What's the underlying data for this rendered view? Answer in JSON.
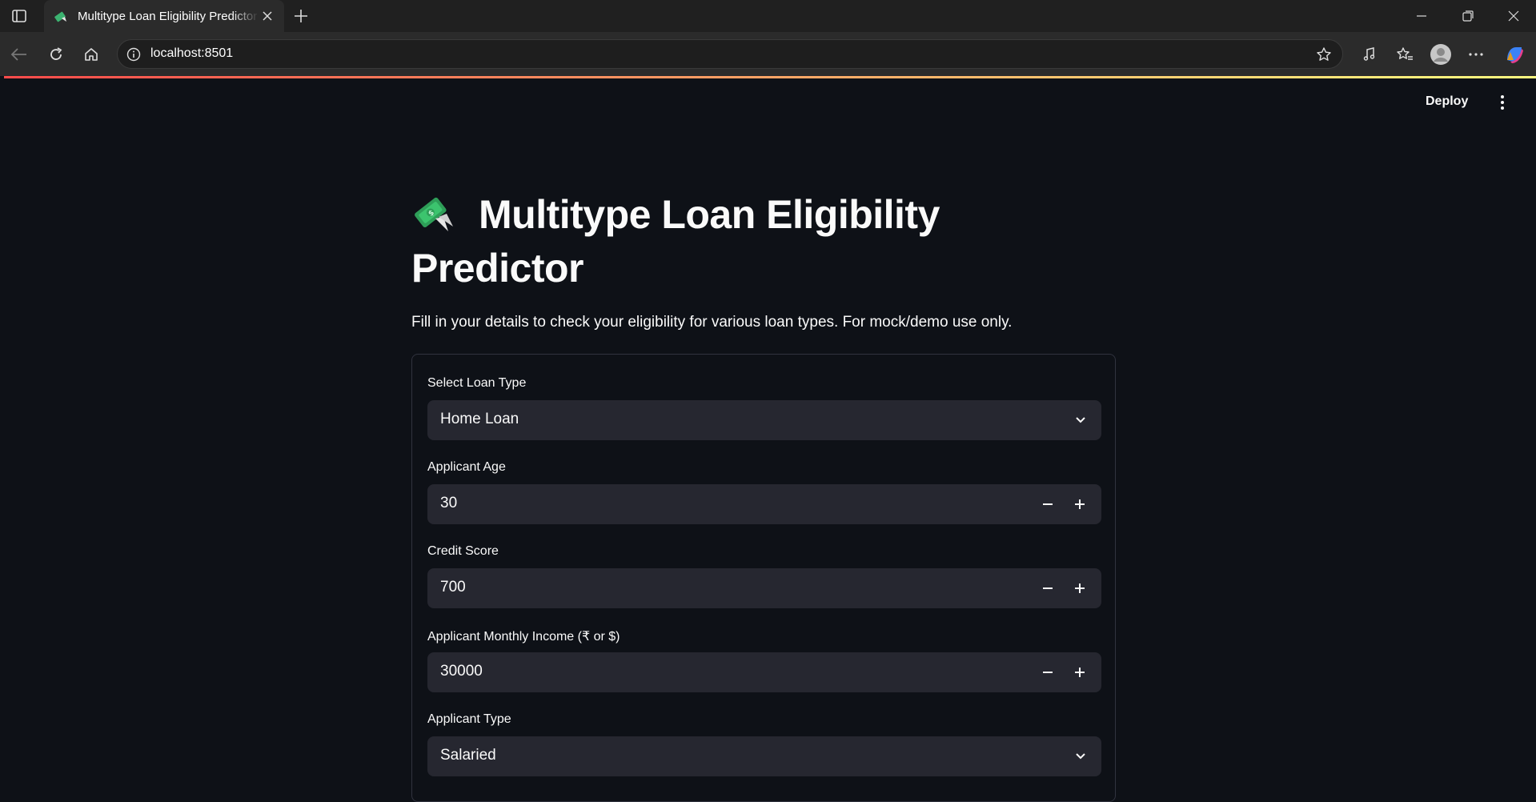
{
  "browser": {
    "tab_title": "Multitype Loan Eligibility Predictor",
    "url": "localhost:8501",
    "icons": {
      "sidebar": "sidebar-icon",
      "close": "close-icon",
      "new_tab": "plus-icon",
      "back": "back-arrow-icon",
      "reload": "reload-icon",
      "home": "home-icon",
      "site_info": "info-icon",
      "favorite": "star-icon",
      "read_aloud": "music-note-icon",
      "favorites": "favorites-icon",
      "profile": "avatar-icon",
      "more": "ellipsis-icon",
      "copilot": "copilot-icon"
    }
  },
  "app": {
    "deploy_label": "Deploy",
    "title": "Multitype Loan Eligibility Predictor",
    "intro": "Fill in your details to check your eligibility for various loan types. For mock/demo use only.",
    "accent_gradient": [
      "#ff4b4b",
      "#fffd80"
    ],
    "fields": {
      "loan_type": {
        "label": "Select Loan Type",
        "value": "Home Loan"
      },
      "age": {
        "label": "Applicant Age",
        "value": "30"
      },
      "credit_score": {
        "label": "Credit Score",
        "value": "700"
      },
      "income": {
        "label": "Applicant Monthly Income (₹ or $)",
        "value": "30000"
      },
      "applicant_type": {
        "label": "Applicant Type",
        "value": "Salaried"
      }
    }
  }
}
